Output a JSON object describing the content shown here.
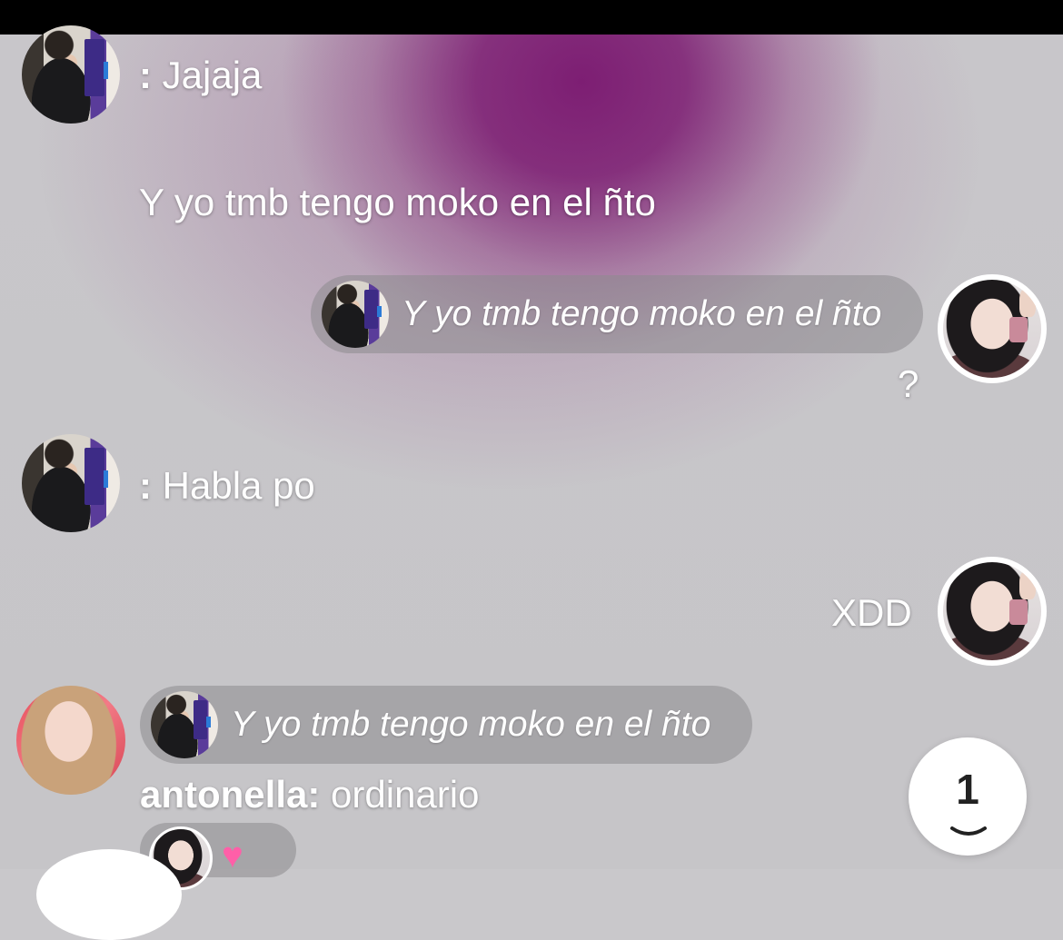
{
  "messages": {
    "m1": {
      "prefix": ":",
      "text": "Jajaja"
    },
    "m2": {
      "text": "Y yo tmb tengo moko en el ñto"
    },
    "m3": {
      "reply_quote": "Y yo tmb tengo moko en el ñto",
      "text": "?"
    },
    "m4": {
      "prefix": ":",
      "text": "Habla po"
    },
    "m5": {
      "text": "XDD"
    },
    "m6": {
      "reply_quote": "Y yo tmb tengo moko en el ñto",
      "sender": "antonella:",
      "text": "ordinario"
    }
  },
  "scroll_button": {
    "count": "1",
    "icon": "chevron-down-icon"
  },
  "colors": {
    "accent_purple": "#7d1e73",
    "status_bar": "#000000",
    "bubble": "#8c8a8e"
  }
}
